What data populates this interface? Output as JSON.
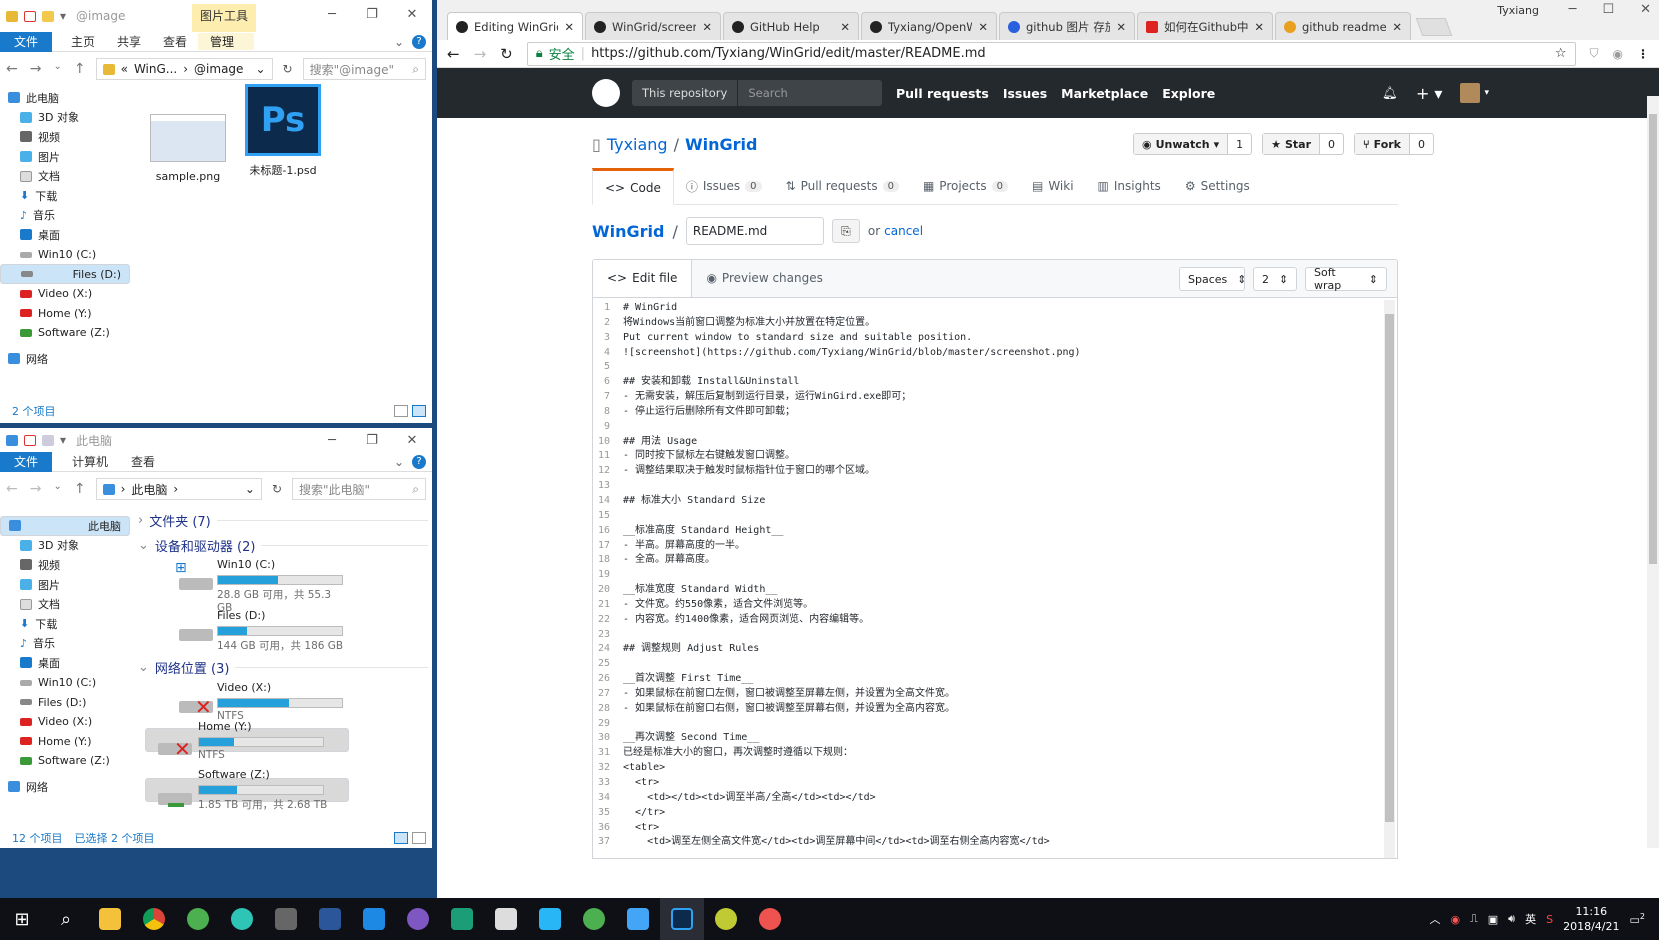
{
  "explorer_top": {
    "title": "@image",
    "tools_tab": "图片工具",
    "tabs": [
      "文件",
      "主页",
      "共享",
      "查看"
    ],
    "manage_tab": "管理",
    "breadcrumb": [
      "WinG...",
      "@image"
    ],
    "search_placeholder": "搜索\"@image\"",
    "sidebar": [
      "此电脑",
      "3D 对象",
      "视频",
      "图片",
      "文档",
      "下载",
      "音乐",
      "桌面",
      "Win10 (C:)",
      "Files (D:)",
      "Video (X:)",
      "Home (Y:)",
      "Software (Z:)",
      "网络"
    ],
    "files": [
      "sample.png",
      "未标题-1.psd"
    ],
    "status": "2 个项目"
  },
  "explorer_bottom": {
    "title": "此电脑",
    "tabs": [
      "文件",
      "计算机",
      "查看"
    ],
    "breadcrumb": [
      "此电脑"
    ],
    "search_placeholder": "搜索\"此电脑\"",
    "sidebar": [
      "此电脑",
      "3D 对象",
      "视频",
      "图片",
      "文档",
      "下载",
      "音乐",
      "桌面",
      "Win10 (C:)",
      "Files (D:)",
      "Video (X:)",
      "Home (Y:)",
      "Software (Z:)",
      "网络"
    ],
    "groups": [
      "文件夹 (7)",
      "设备和驱动器 (2)",
      "网络位置 (3)"
    ],
    "drives": [
      {
        "name": "Win10 (C:)",
        "sub": "28.8 GB 可用，共 55.3 GB",
        "used": 0.48
      },
      {
        "name": "Files (D:)",
        "sub": "144 GB 可用，共 186 GB",
        "used": 0.23
      },
      {
        "name": "Video (X:)",
        "sub": "NTFS",
        "used": 0.57
      },
      {
        "name": "Home (Y:)",
        "sub": "NTFS",
        "used": 0.28
      },
      {
        "name": "Software (Z:)",
        "sub": "1.85 TB 可用，共 2.68 TB",
        "used": 0.31
      }
    ],
    "status_items": "12 个项目",
    "status_selected": "已选择 2 个项目"
  },
  "chrome": {
    "user": "Tyxiang",
    "tabs": [
      "Editing WinGrid/R",
      "WinGrid/screensh",
      "GitHub Help",
      "Tyxiang/OpenWit",
      "github 图片 存放_",
      "如何在Github中添",
      "github readme.m"
    ],
    "secure_label": "安全",
    "url": "https://github.com/Tyxiang/WinGrid/edit/master/README.md"
  },
  "github": {
    "search_scope": "This repository",
    "search_placeholder": "Search",
    "nav": [
      "Pull requests",
      "Issues",
      "Marketplace",
      "Explore"
    ],
    "owner": "Tyxiang",
    "repo": "WinGrid",
    "unwatch": "Unwatch",
    "unwatch_count": "1",
    "star": "Star",
    "star_count": "0",
    "fork": "Fork",
    "fork_count": "0",
    "repo_tabs": [
      {
        "label": "Code",
        "count": ""
      },
      {
        "label": "Issues",
        "count": "0"
      },
      {
        "label": "Pull requests",
        "count": "0"
      },
      {
        "label": "Projects",
        "count": "0"
      },
      {
        "label": "Wiki",
        "count": ""
      },
      {
        "label": "Insights",
        "count": ""
      },
      {
        "label": "Settings",
        "count": ""
      }
    ],
    "path_repo": "WinGrid",
    "filename": "README.md",
    "or_text": "or",
    "cancel": "cancel",
    "edit_tab": "Edit file",
    "preview_tab": "Preview changes",
    "indent_mode": "Spaces",
    "indent_size": "2",
    "wrap_mode": "Soft wrap",
    "code_lines": [
      "# WinGrid",
      "将Windows当前窗口调整为标准大小并放置在特定位置。",
      "Put current window to standard size and suitable position.",
      "![screenshot](https://github.com/Tyxiang/WinGrid/blob/master/screenshot.png)",
      "",
      "## 安装和卸载 Install&Uninstall",
      "- 无需安装，解压后复制到运行目录，运行WinGird.exe即可；",
      "- 停止运行后删除所有文件即可卸载；",
      "",
      "## 用法 Usage",
      "- 同时按下鼠标左右键触发窗口调整。",
      "- 调整结果取决于触发时鼠标指针位于窗口的哪个区域。",
      "",
      "## 标准大小 Standard Size",
      "",
      "__标准高度 Standard Height__",
      "- 半高。屏幕高度的一半。",
      "- 全高。屏幕高度。",
      "",
      "__标准宽度 Standard Width__",
      "- 文件宽。约550像素，适合文件浏览等。",
      "- 内容宽。约1400像素，适合网页浏览、内容编辑等。",
      "",
      "## 调整规则 Adjust Rules",
      "",
      "__首次调整 First Time__",
      "- 如果鼠标在前窗口左侧，窗口被调整至屏幕左侧，并设置为全高文件宽。",
      "- 如果鼠标在前窗口右侧，窗口被调整至屏幕右侧，并设置为全高内容宽。",
      "",
      "__再次调整 Second Time__",
      "已经是标准大小的窗口，再次调整时遵循以下规则：",
      "<table>",
      "  <tr>",
      "    <td></td><td>调至半高/全高</td><td></td>",
      "  </tr>",
      "  <tr>",
      "    <td>调至左侧全高文件宽</td><td>调至屏幕中间</td><td>调至右侧全高内容宽</td>"
    ]
  },
  "taskbar": {
    "ime": "英",
    "time": "11:16",
    "date": "2018/4/21",
    "notif_count": "2"
  }
}
